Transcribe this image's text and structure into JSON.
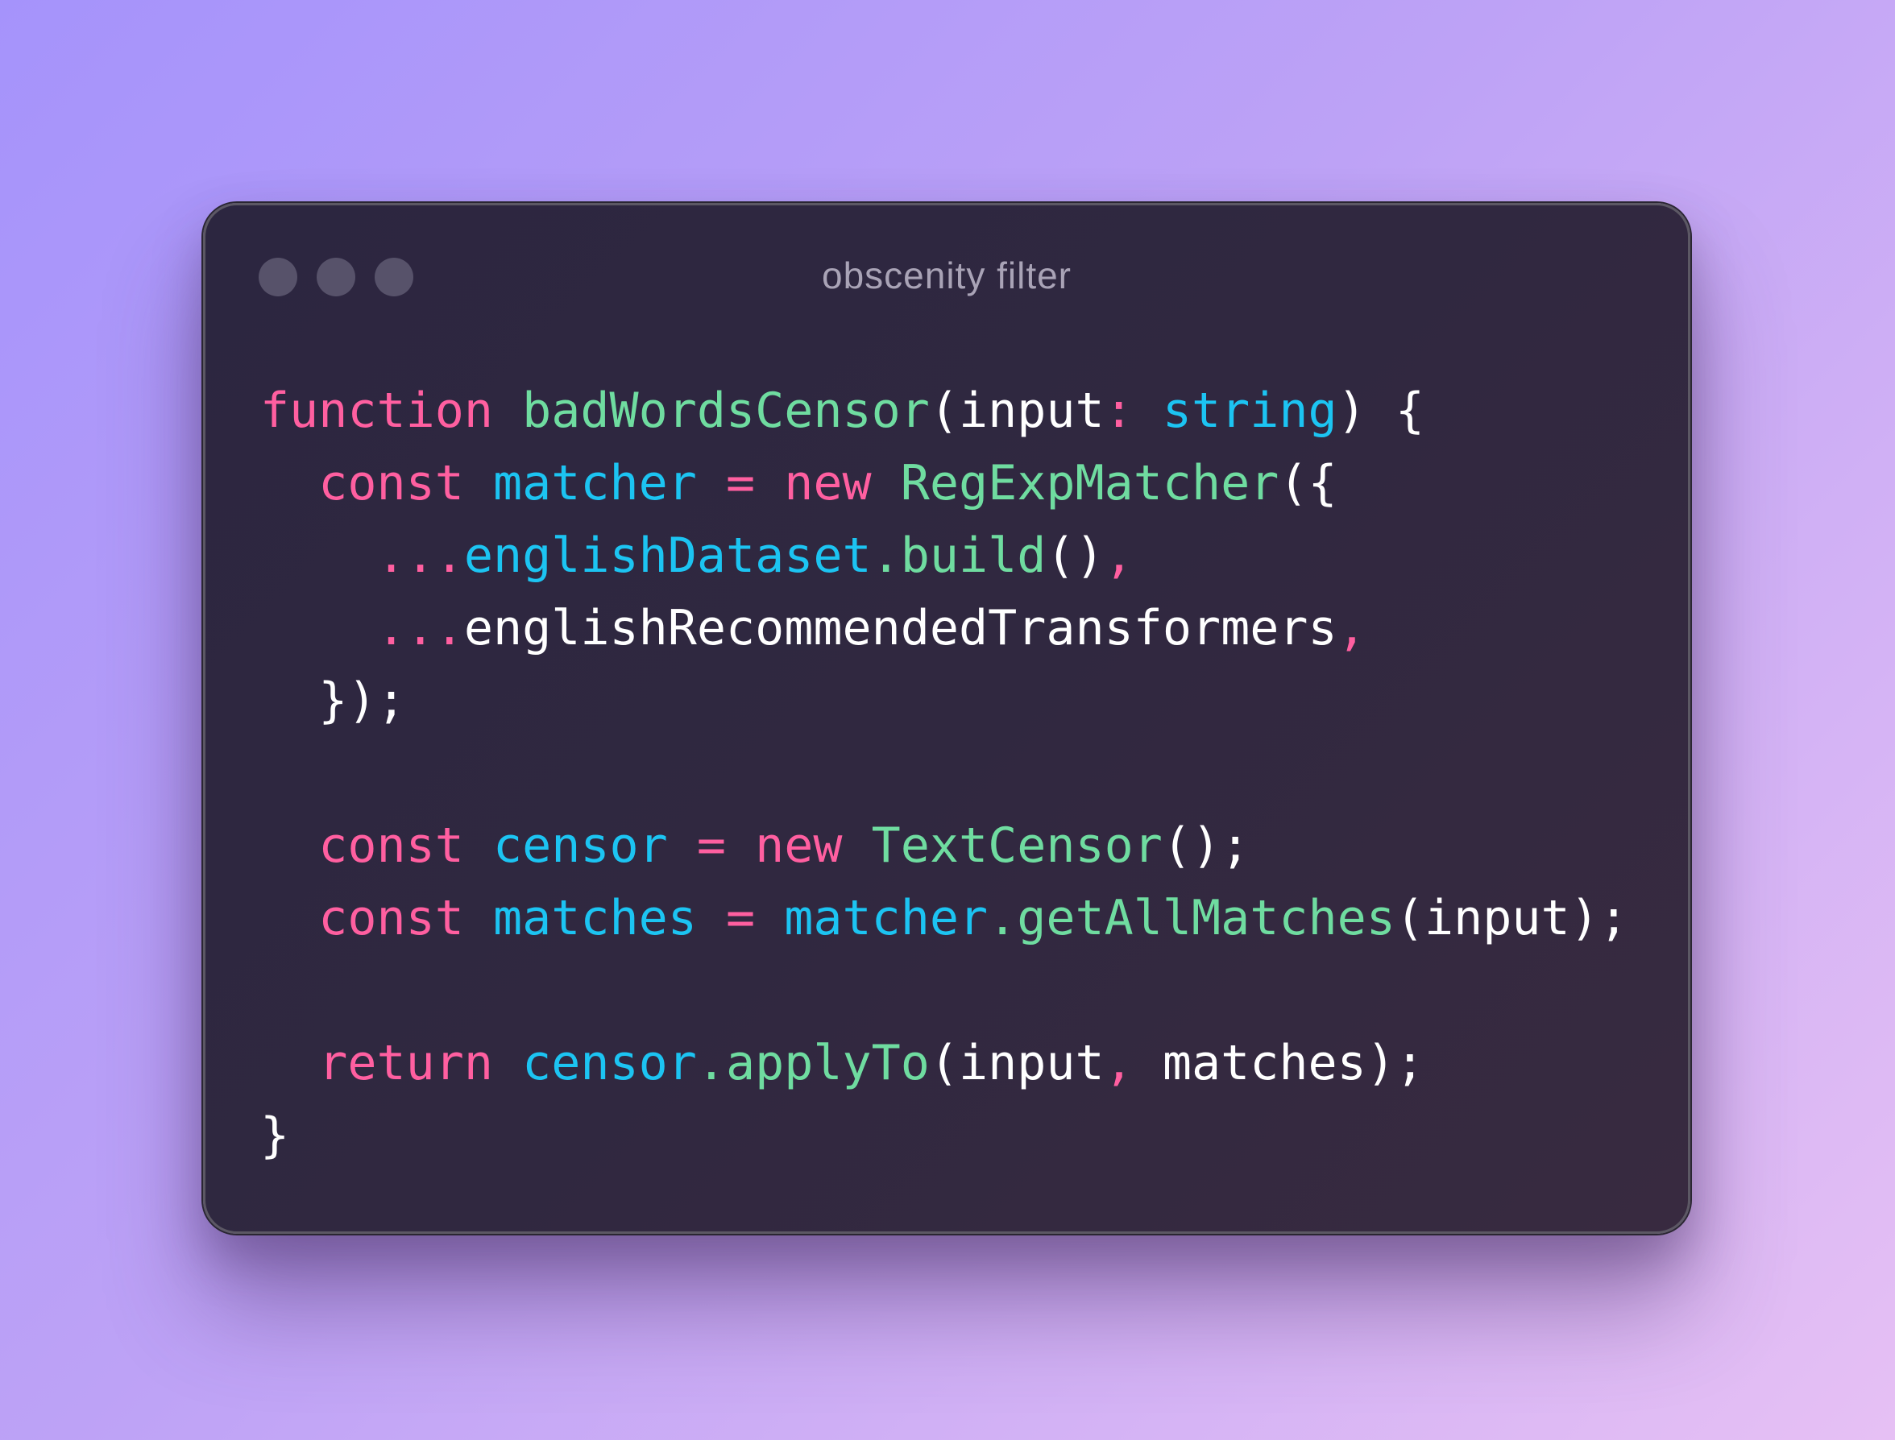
{
  "window": {
    "title": "obscenity filter",
    "controls": [
      "close",
      "minimize",
      "maximize"
    ]
  },
  "colors": {
    "keyword": "#ff5fa0",
    "function": "#6fdca0",
    "variable": "#1cc4f2",
    "plain": "#ffffff",
    "window_bg": "#2e2840",
    "background_start": "#a593fb",
    "background_end": "#e6c0f4"
  },
  "code": {
    "language": "typescript",
    "lines": [
      [
        {
          "t": "function",
          "c": "kw"
        },
        {
          "t": " ",
          "c": "pun"
        },
        {
          "t": "badWordsCensor",
          "c": "fn"
        },
        {
          "t": "(input",
          "c": "pun"
        },
        {
          "t": ":",
          "c": "pk"
        },
        {
          "t": " ",
          "c": "pun"
        },
        {
          "t": "string",
          "c": "var"
        },
        {
          "t": ") {",
          "c": "pun"
        }
      ],
      [
        {
          "t": "  ",
          "c": "pun"
        },
        {
          "t": "const",
          "c": "kw"
        },
        {
          "t": " ",
          "c": "pun"
        },
        {
          "t": "matcher",
          "c": "var"
        },
        {
          "t": " ",
          "c": "pun"
        },
        {
          "t": "=",
          "c": "pk"
        },
        {
          "t": " ",
          "c": "pun"
        },
        {
          "t": "new",
          "c": "kw"
        },
        {
          "t": " ",
          "c": "pun"
        },
        {
          "t": "RegExpMatcher",
          "c": "fn"
        },
        {
          "t": "({",
          "c": "pun"
        }
      ],
      [
        {
          "t": "    ",
          "c": "pun"
        },
        {
          "t": "...",
          "c": "pk"
        },
        {
          "t": "englishDataset",
          "c": "var"
        },
        {
          "t": ".build",
          "c": "fn"
        },
        {
          "t": "()",
          "c": "pun"
        },
        {
          "t": ",",
          "c": "pk"
        }
      ],
      [
        {
          "t": "    ",
          "c": "pun"
        },
        {
          "t": "...",
          "c": "pk"
        },
        {
          "t": "englishRecommendedTransformers",
          "c": "pun"
        },
        {
          "t": ",",
          "c": "pk"
        }
      ],
      [
        {
          "t": "  });",
          "c": "pun"
        }
      ],
      [],
      [
        {
          "t": "  ",
          "c": "pun"
        },
        {
          "t": "const",
          "c": "kw"
        },
        {
          "t": " ",
          "c": "pun"
        },
        {
          "t": "censor",
          "c": "var"
        },
        {
          "t": " ",
          "c": "pun"
        },
        {
          "t": "=",
          "c": "pk"
        },
        {
          "t": " ",
          "c": "pun"
        },
        {
          "t": "new",
          "c": "kw"
        },
        {
          "t": " ",
          "c": "pun"
        },
        {
          "t": "TextCensor",
          "c": "fn"
        },
        {
          "t": "();",
          "c": "pun"
        }
      ],
      [
        {
          "t": "  ",
          "c": "pun"
        },
        {
          "t": "const",
          "c": "kw"
        },
        {
          "t": " ",
          "c": "pun"
        },
        {
          "t": "matches",
          "c": "var"
        },
        {
          "t": " ",
          "c": "pun"
        },
        {
          "t": "=",
          "c": "pk"
        },
        {
          "t": " ",
          "c": "pun"
        },
        {
          "t": "matcher",
          "c": "var"
        },
        {
          "t": ".getAllMatches",
          "c": "fn"
        },
        {
          "t": "(input);",
          "c": "pun"
        }
      ],
      [],
      [
        {
          "t": "  ",
          "c": "pun"
        },
        {
          "t": "return",
          "c": "kw"
        },
        {
          "t": " ",
          "c": "pun"
        },
        {
          "t": "censor",
          "c": "var"
        },
        {
          "t": ".applyTo",
          "c": "fn"
        },
        {
          "t": "(input",
          "c": "pun"
        },
        {
          "t": ",",
          "c": "pk"
        },
        {
          "t": " matches);",
          "c": "pun"
        }
      ],
      [
        {
          "t": "}",
          "c": "pun"
        }
      ]
    ]
  }
}
